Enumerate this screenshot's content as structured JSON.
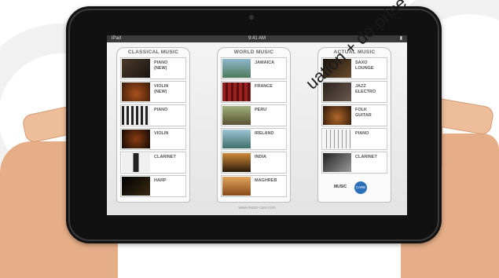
{
  "device": {
    "status_left": "iPad",
    "status_time": "9:41 AM",
    "status_right": "",
    "footer_url": "www.music-care.com"
  },
  "columns": [
    {
      "title": "CLASSICAL MUSIC",
      "items": [
        {
          "label": "PIANO\n(NEW)",
          "thumb_color": "#4a3a2c"
        },
        {
          "label": "VIOLIN\n(NEW)",
          "thumb_color": "#7a3a14"
        },
        {
          "label": "PIANO",
          "thumb_color": "#2a2a2a"
        },
        {
          "label": "VIOLIN",
          "thumb_color": "#5c2a0e"
        },
        {
          "label": "CLARINET",
          "thumb_color": "#3a3a3a"
        },
        {
          "label": "HARP",
          "thumb_color": "#111111"
        }
      ]
    },
    {
      "title": "WORLD MUSIC",
      "items": [
        {
          "label": "JAMAICA",
          "thumb_color": "#5b8aa8"
        },
        {
          "label": "FRANCE",
          "thumb_color": "#8a1f1f"
        },
        {
          "label": "PERU",
          "thumb_color": "#6d7a4b"
        },
        {
          "label": "IRELAND",
          "thumb_color": "#4d7a8a"
        },
        {
          "label": "INDIA",
          "thumb_color": "#a4692a"
        },
        {
          "label": "MAGHREB",
          "thumb_color": "#b0642a"
        }
      ]
    },
    {
      "title": "ACTUAL MUSIC",
      "items": [
        {
          "label": "SAXO\nLOUNGE",
          "thumb_color": "#2f2620"
        },
        {
          "label": "JAZZ\nELECTRO",
          "thumb_color": "#3b2f2a"
        },
        {
          "label": "FOLK\nGUITAR",
          "thumb_color": "#6a3a18"
        },
        {
          "label": "PIANO",
          "thumb_color": "#dcdcdc"
        },
        {
          "label": "CLARINET",
          "thumb_color": "#4a4a4a"
        }
      ],
      "logo_text": "MUSIC",
      "logo_circle": "CARE"
    }
  ],
  "watermark": "uation  + de prise en charge",
  "colors": {
    "skin": "#e9b48f",
    "frame": "#111111",
    "accent_logo": "#2a6fb8"
  }
}
